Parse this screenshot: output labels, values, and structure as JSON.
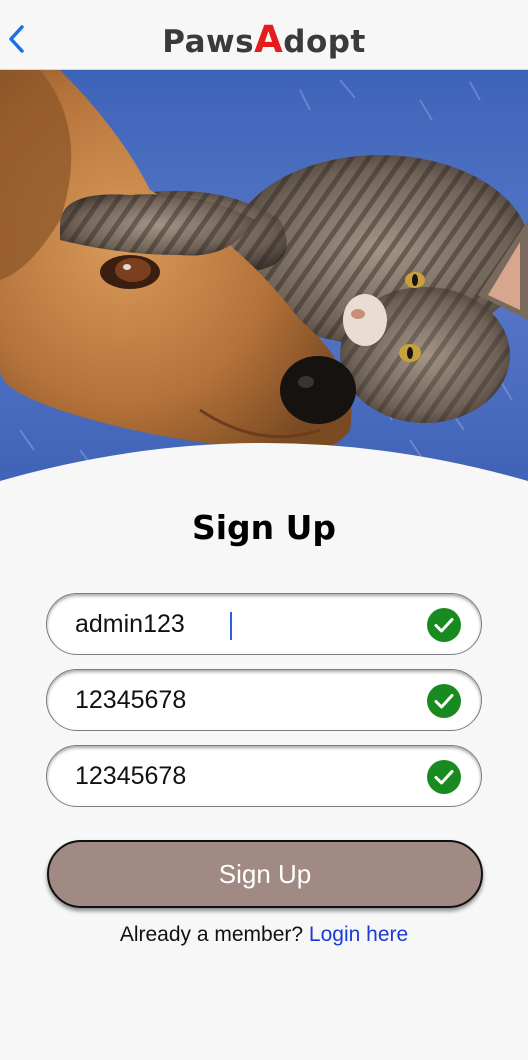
{
  "header": {
    "back_icon": "chevron-left-icon",
    "logo_part1": "Paws",
    "logo_accent": "A",
    "logo_part2": "dopt",
    "accent_color": "#e41c1c"
  },
  "hero": {
    "image": "dog-and-kitten-photo"
  },
  "form": {
    "title": "Sign Up",
    "fields": [
      {
        "value": "admin123",
        "valid": true,
        "icon": "check-circle-icon"
      },
      {
        "value": "12345678",
        "valid": true,
        "icon": "check-circle-icon"
      },
      {
        "value": "12345678",
        "valid": true,
        "icon": "check-circle-icon"
      }
    ],
    "submit_label": "Sign Up",
    "button_color": "#a18a84"
  },
  "footer": {
    "prompt": "Already a member?",
    "link": "Login here",
    "link_color": "#1a3bd6"
  }
}
